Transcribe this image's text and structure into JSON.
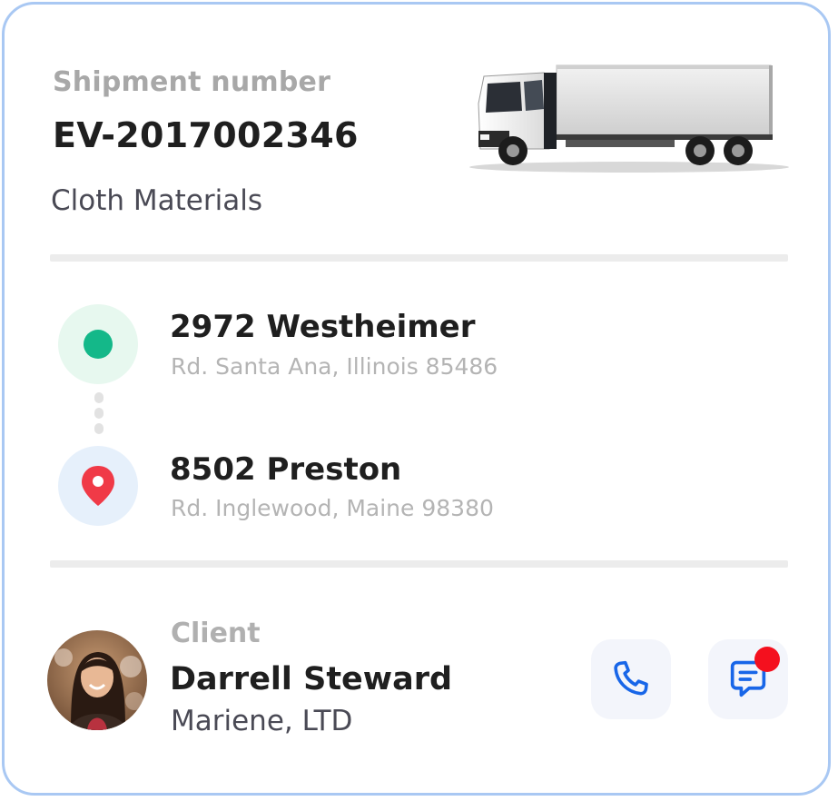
{
  "shipment": {
    "label": "Shipment number",
    "number": "EV-2017002346",
    "cargo": "Cloth Materials",
    "vehicle_icon": "truck-image"
  },
  "route": {
    "origin": {
      "title": "2972 Westheimer",
      "subtitle": "Rd. Santa Ana, Illinois 85486",
      "icon": "origin-dot-icon",
      "color": "#14b889"
    },
    "destination": {
      "title": "8502 Preston",
      "subtitle": "Rd. Inglewood, Maine 98380",
      "icon": "map-pin-icon",
      "color": "#f03a47"
    }
  },
  "client": {
    "label": "Client",
    "name": "Darrell Steward",
    "company": "Mariene, LTD",
    "avatar_icon": "avatar-photo"
  },
  "actions": {
    "call_icon": "phone-icon",
    "message_icon": "chat-icon",
    "message_badge_color": "#f4101e",
    "accent_color": "#1866e8"
  },
  "theme": {
    "border_color": "#a9c8f3",
    "text_primary": "#1f1f1f",
    "text_muted": "#b4b4b4"
  }
}
